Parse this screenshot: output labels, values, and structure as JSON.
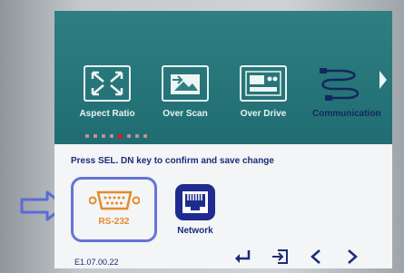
{
  "menu": {
    "items": [
      {
        "label": "Aspect Ratio",
        "icon": "aspect-ratio-icon"
      },
      {
        "label": "Over Scan",
        "icon": "over-scan-icon"
      },
      {
        "label": "Over Drive",
        "icon": "over-drive-icon"
      },
      {
        "label": "Communication",
        "icon": "communication-icon",
        "selected": true
      }
    ],
    "page_indicator": {
      "count": 8,
      "active_index": 4
    }
  },
  "hint": "Press SEL. DN key to confirm and save change",
  "options": [
    {
      "label": "RS-232",
      "icon": "serial-port-icon",
      "selected": true
    },
    {
      "label": "Network",
      "icon": "network-port-icon"
    }
  ],
  "footer": {
    "version": "E1.07.00.22",
    "buttons": [
      "enter-icon",
      "exit-icon",
      "left-arrow-icon",
      "right-arrow-icon"
    ]
  },
  "colors": {
    "teal": "#2f7f82",
    "navy": "#1b2b7a",
    "accent_orange": "#e58a2c",
    "selection_blue": "#6475d6"
  }
}
